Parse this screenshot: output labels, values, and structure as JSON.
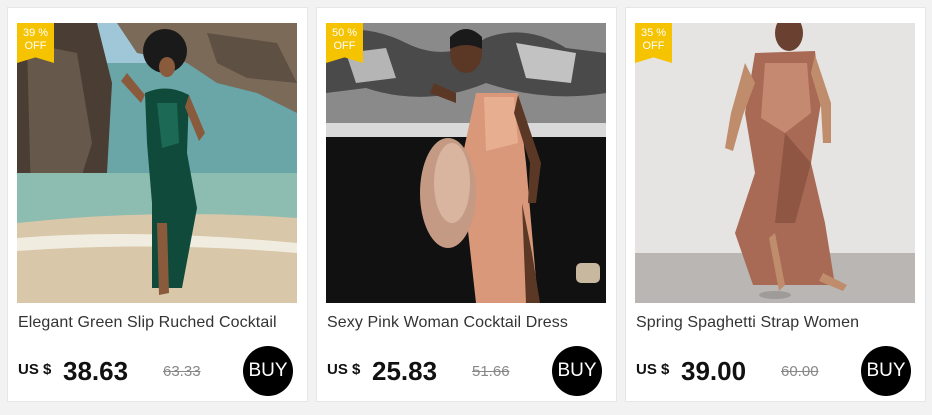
{
  "products": [
    {
      "discount_value": "39 %",
      "discount_label": "OFF",
      "title": "Elegant Green Slip Ruched Cocktail",
      "currency": "US $",
      "price": "38.63",
      "original_price": "63.33",
      "buy_label": "BUY",
      "image": "model-green-satin-dress-beach"
    },
    {
      "discount_value": "50 %",
      "discount_label": "OFF",
      "title": "Sexy Pink Woman Cocktail Dress",
      "currency": "US $",
      "price": "25.83",
      "original_price": "51.66",
      "buy_label": "BUY",
      "image": "model-pink-satin-dress-graffiti"
    },
    {
      "discount_value": "35 %",
      "discount_label": "OFF",
      "title": "Spring Spaghetti Strap Women",
      "currency": "US $",
      "price": "39.00",
      "original_price": "60.00",
      "buy_label": "BUY",
      "image": "model-rose-satin-dress-studio"
    }
  ],
  "colors": {
    "badge": "#f5c300",
    "buy_button": "#000000",
    "price": "#111111",
    "old_price": "#888888"
  }
}
